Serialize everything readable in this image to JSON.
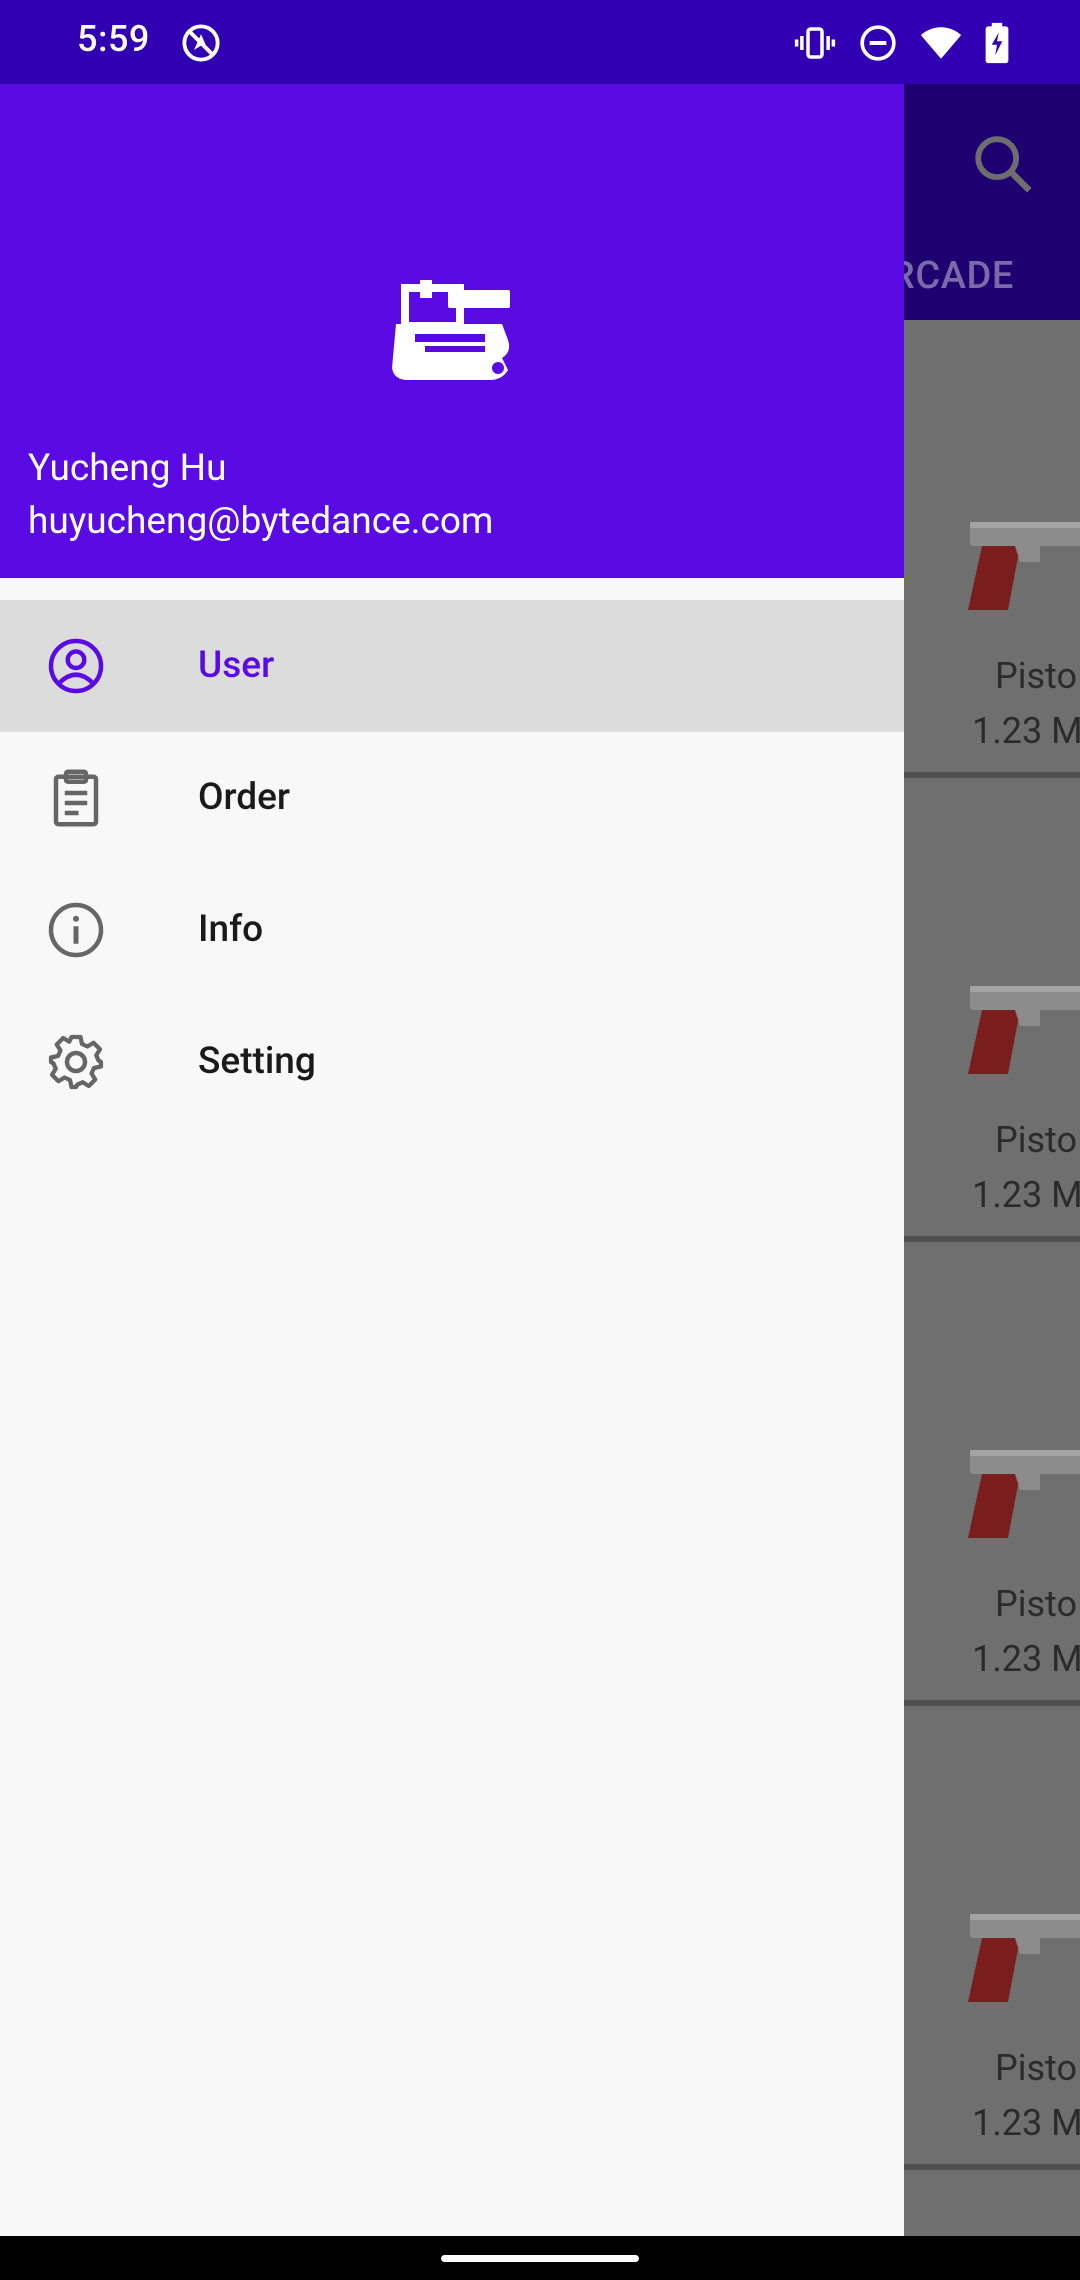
{
  "status_bar": {
    "time": "5:59",
    "left_icons": [
      "no-location-icon"
    ],
    "right_icons": [
      "vibrate-icon",
      "do-not-disturb-icon",
      "wifi-icon",
      "battery-charging-icon"
    ]
  },
  "background_app": {
    "toolbar": {
      "search_icon": "search-icon",
      "visible_tab_label": "ARCADE"
    },
    "cards": [
      {
        "name": "Pisto",
        "size": "1.23 M"
      },
      {
        "name": "Pisto",
        "size": "1.23 M"
      },
      {
        "name": "Pisto",
        "size": "1.23 M"
      },
      {
        "name": "Pisto",
        "size": "1.23 M"
      }
    ]
  },
  "drawer": {
    "header": {
      "logo_icon": "robot-tank-icon",
      "user_name": "Yucheng Hu",
      "user_email": "huyucheng@bytedance.com"
    },
    "menu": [
      {
        "label": "User",
        "icon": "account-circle-icon",
        "active": true
      },
      {
        "label": "Order",
        "icon": "clipboard-icon",
        "active": false
      },
      {
        "label": "Info",
        "icon": "info-icon",
        "active": false
      },
      {
        "label": "Setting",
        "icon": "gear-icon",
        "active": false
      }
    ]
  },
  "colors": {
    "status_bar_bg": "#3200b3",
    "drawer_header_bg": "#5a0be3",
    "accent": "#5a0be3",
    "active_item_bg": "#dcdcdc",
    "drawer_bg": "#f8f8f8",
    "scrim_bg": "#6f6f6f"
  }
}
